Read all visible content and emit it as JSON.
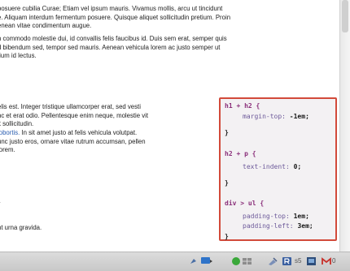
{
  "paragraphs": {
    "p1": [
      "posuere cubilia Curae; Etiam vel ipsum mauris. Vivamus mollis, arcu ut tincidunt",
      "e. Aliquam interdum fermentum posuere. Quisque aliquet sollicitudin pretium. Proin",
      "enean vitae condimentum augue."
    ],
    "p2": [
      "n commodo molestie dui, id convallis felis faucibus id. Duis sem erat, semper quis",
      "d bibendum sed, tempor sed mauris. Aenean vehicula lorem ac justo semper ut",
      "tium id lectus."
    ],
    "p3": [
      "elis est. Integer tristique ullamcorper erat, sed vesti",
      "nc et erat odio. Pellentesque enim neque, molestie vit",
      "it sollicitudin."
    ],
    "p4_link": "lobortis.",
    "p4_rest": " In sit amet justo at felis vehicula volutpat.",
    "p4": [
      "unc justo eros, ornare vitae rutrum accumsan, pellen",
      "lorem."
    ],
    "p5": "l.",
    "p6": "nt urna gravida."
  },
  "css_code": [
    {
      "type": "selector",
      "text": "h1 + h2 {"
    },
    {
      "type": "decl",
      "prop": "margin-top:",
      "val": " -1em;"
    },
    {
      "type": "brace",
      "text": "}"
    },
    {
      "type": "selector",
      "text": "h2 + p {"
    },
    {
      "type": "decl",
      "prop": "text-indent:",
      "val": " 0;"
    },
    {
      "type": "brace",
      "text": "}"
    },
    {
      "type": "selector",
      "text": "div > ul {"
    },
    {
      "type": "decl",
      "prop": "padding-top:",
      "val": " 1em;"
    },
    {
      "type": "decl",
      "prop": "padding-left:",
      "val": " 3em;"
    },
    {
      "type": "brace",
      "text": "}"
    }
  ],
  "tray": {
    "status_text": "s5",
    "mail_text": "0"
  },
  "colors": {
    "code_border": "#d24a3a",
    "selector": "#8a2f7a",
    "property": "#6d5a9a",
    "link": "#2a5db0"
  }
}
